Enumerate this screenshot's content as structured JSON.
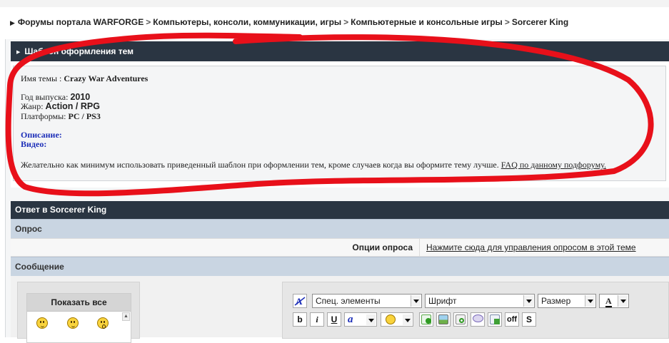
{
  "breadcrumb": {
    "items": [
      "Форумы портала WARFORGE",
      "Компьютеры, консоли, коммуникации, игры",
      "Компьютерные и консольные игры",
      "Sorcerer King"
    ],
    "separator": ">"
  },
  "template_panel": {
    "header": "Шаблон оформления тем",
    "topic_name_label": "Имя темы :",
    "topic_name_value": "Crazy War Adventures",
    "year_label": "Год выпуска:",
    "year_value": "2010",
    "genre_label": "Жанр:",
    "genre_value": "Action / RPG",
    "platform_label": "Платформы:",
    "platform_value": "PC / PS3",
    "description_label": "Описание:",
    "video_label": "Видео:",
    "note_text": "Желательно как минимум использовать приведенный шаблон при оформлении тем, кроме случаев когда вы оформите тему лучше.",
    "note_link": "FAQ по данному подфоруму."
  },
  "reply_panel": {
    "header": "Ответ в Sorcerer King",
    "poll_section": "Опрос",
    "poll_options_label": "Опции опроса",
    "poll_options_link": "Нажмите сюда для управления опросом в этой теме",
    "message_section": "Сообщение",
    "show_all": "Показать все"
  },
  "editor": {
    "special_elements": "Спец. элементы",
    "font": "Шрифт",
    "size": "Размер",
    "color_button": "A",
    "bold": "b",
    "italic": "i",
    "underline": "U",
    "strike": "S",
    "off_button": "off"
  },
  "colors": {
    "header_bg": "#2a3542",
    "section_bg": "#c9d5e2",
    "label_blue": "#1c2eb8",
    "annotation_red": "#e8101a"
  }
}
